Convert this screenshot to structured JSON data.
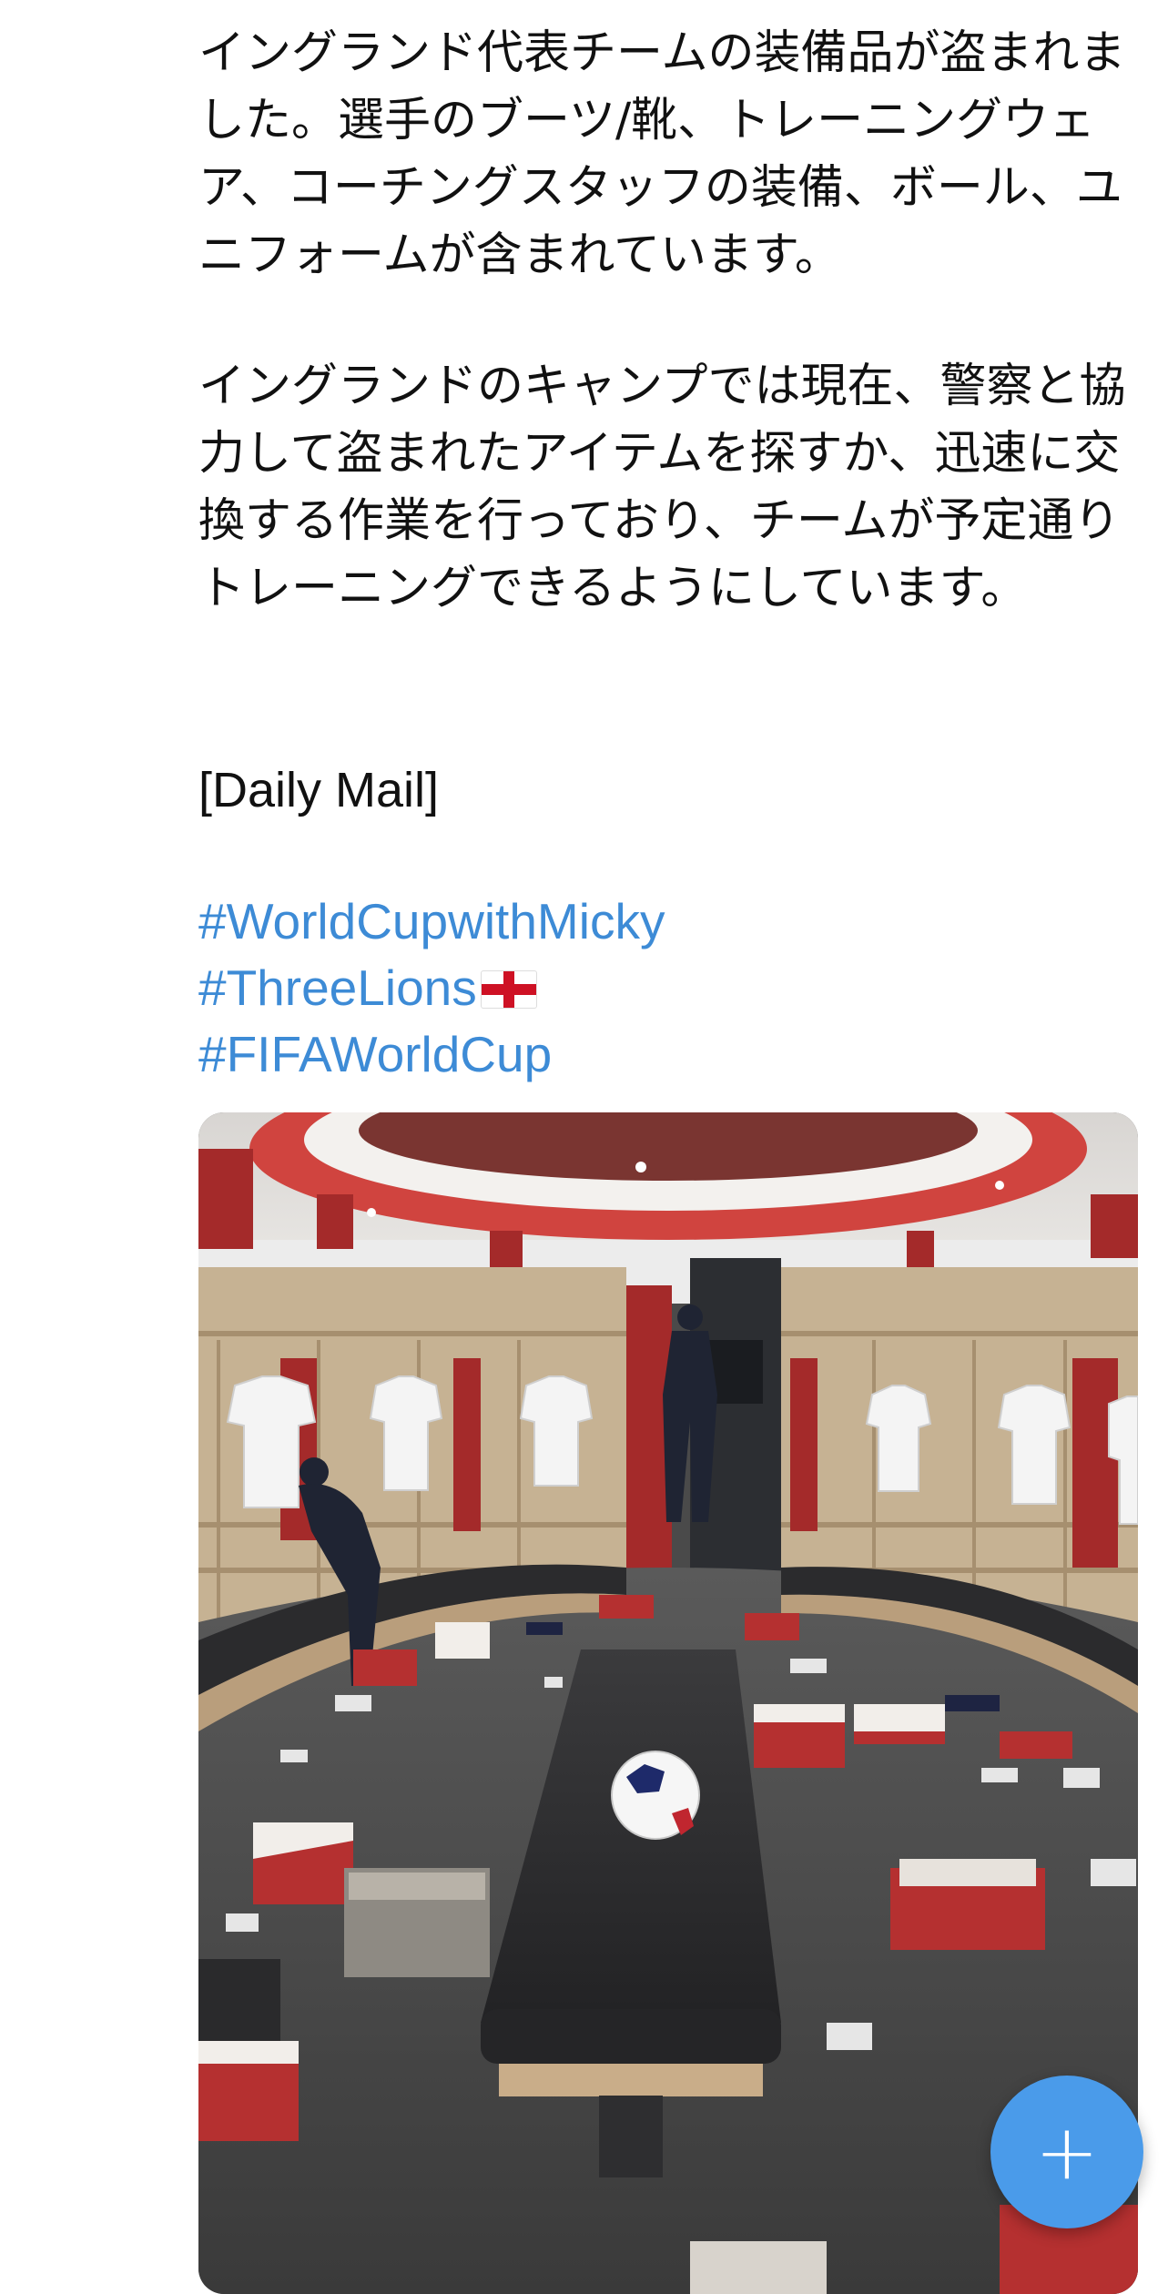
{
  "post": {
    "paragraph1": "イングランド代表チームの装備品が盗まれました。選手のブーツ/靴、トレーニングウェア、コーチングスタッフの装備、ボール、ユニフォームが含まれています。",
    "paragraph2": "イングランドのキャンプでは現在、警察と協力して盗まれたアイテムを探すか、迅速に交換する作業を行っており、チームが予定通りトレーニングできるようにしています。",
    "source": "[Daily Mail]",
    "hashtags": [
      "#WorldCupwithMicky",
      "#ThreeLions",
      "#FIFAWorldCup"
    ]
  },
  "colors": {
    "hashtag": "#3d8bd6",
    "fab": "#4a9bea"
  },
  "icons": {
    "flag": "england-flag-icon",
    "fab": "plus-icon"
  },
  "fab": {
    "label": "+"
  }
}
